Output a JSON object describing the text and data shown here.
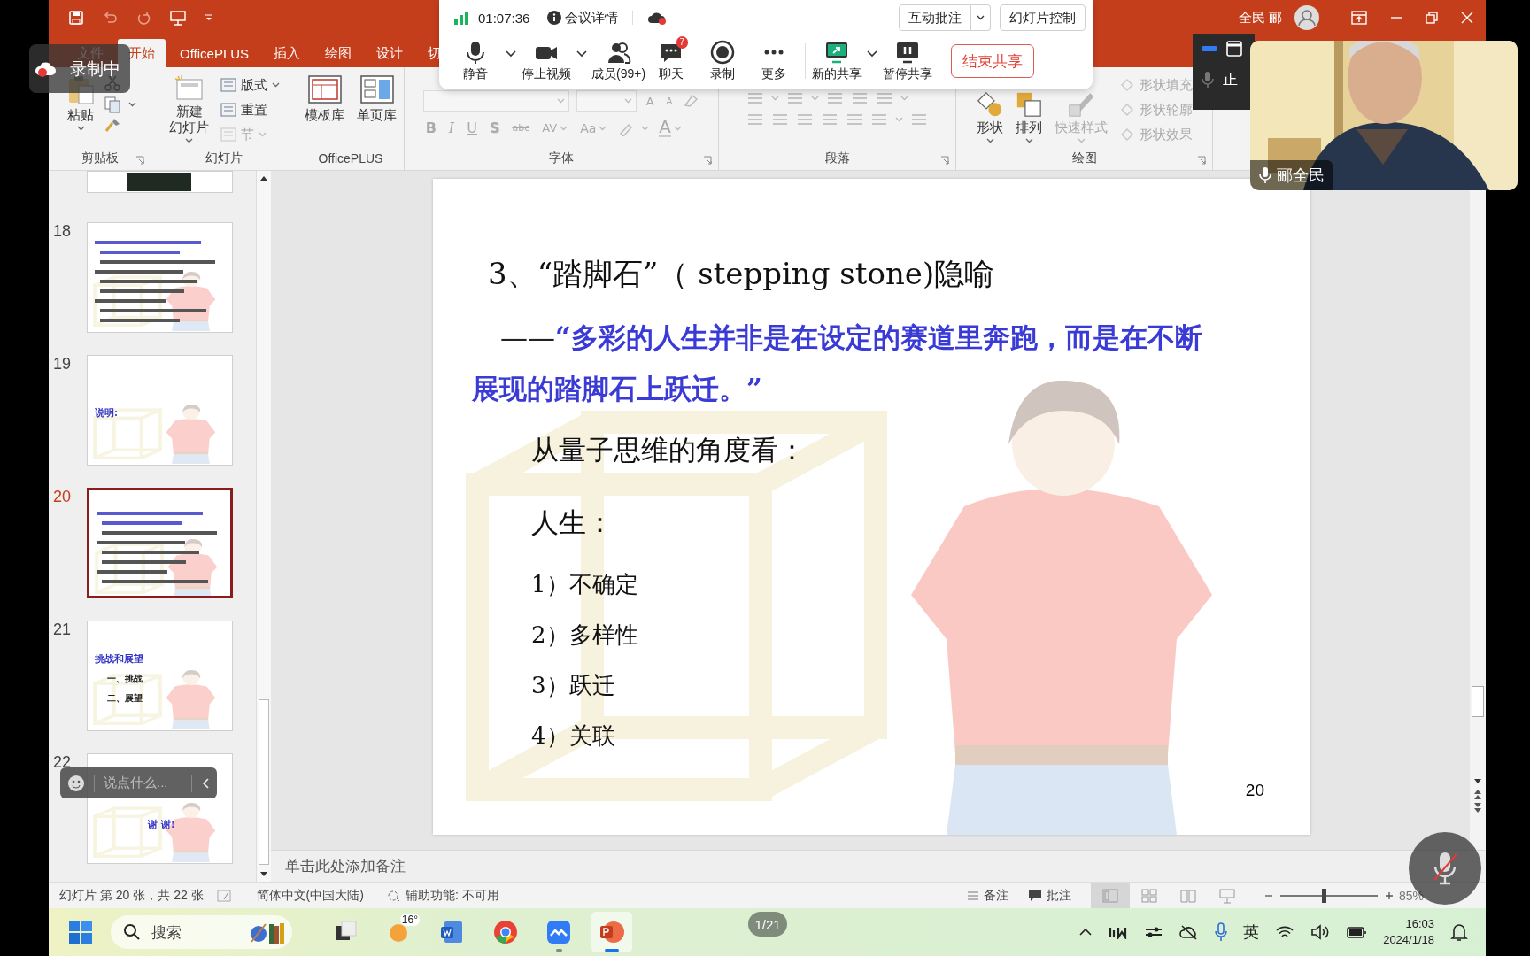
{
  "title_bar": {
    "user": "全民 郦"
  },
  "recording_badge": {
    "label": "录制中"
  },
  "ribbon": {
    "tabs": [
      {
        "label": "文件",
        "selected": false
      },
      {
        "label": "开始",
        "selected": true
      },
      {
        "label": "OfficePLUS",
        "selected": false
      },
      {
        "label": "插入",
        "selected": false
      },
      {
        "label": "绘图",
        "selected": false
      },
      {
        "label": "设计",
        "selected": false
      },
      {
        "label": "切",
        "selected": false
      }
    ],
    "clipboard": {
      "label": "剪贴板",
      "paste": "粘贴"
    },
    "slides": {
      "label": "幻灯片",
      "new_slide": [
        "新建",
        "幻灯片"
      ],
      "items": [
        {
          "label": "版式",
          "disabled": false
        },
        {
          "label": "重置",
          "disabled": false
        },
        {
          "label": "节",
          "disabled": true
        }
      ]
    },
    "officeplus": {
      "label": "OfficePLUS",
      "buttons": [
        "模板库",
        "单页库"
      ]
    },
    "font": {
      "label": "字体",
      "size_buttons": [
        {
          "kind": "grow",
          "label": "A",
          "disabled": true
        },
        {
          "kind": "shrink",
          "label": "A",
          "disabled": true
        }
      ],
      "buttons": [
        {
          "kind": "bold",
          "label": "B",
          "disabled": true
        },
        {
          "kind": "italic",
          "label": "I",
          "disabled": true
        },
        {
          "kind": "underline",
          "label": "U",
          "disabled": true
        },
        {
          "kind": "shadow",
          "label": "S",
          "disabled": true
        },
        {
          "kind": "strike",
          "label": "abc",
          "disabled": true
        },
        {
          "kind": "spacing",
          "label": "AV",
          "disabled": true
        },
        {
          "kind": "case",
          "label": "Aa",
          "disabled": true
        },
        {
          "kind": "color",
          "label": "A",
          "disabled": true
        }
      ]
    },
    "paragraph": {
      "label": "段落"
    },
    "drawing": {
      "label": "绘图",
      "big_buttons": [
        {
          "label": "形状",
          "disabled": false
        },
        {
          "label": "排列",
          "disabled": false
        },
        {
          "label": "快速样式",
          "disabled": true
        }
      ],
      "small_buttons": [
        {
          "label": "形状填充",
          "disabled": true
        },
        {
          "label": "形状轮廓",
          "disabled": true
        },
        {
          "label": "形状效果",
          "disabled": true
        }
      ]
    }
  },
  "meeting_toolbar": {
    "timer": "01:07:36",
    "details": "会议详情",
    "annotate": "互动批注",
    "slide_control": "幻灯片控制",
    "end_share": "结束共享",
    "buttons": [
      {
        "kind": "mic",
        "label": "静音",
        "menu": true
      },
      {
        "kind": "camera",
        "label": "停止视频",
        "menu": true
      },
      {
        "kind": "members",
        "label": "成员(99+)",
        "menu": false
      },
      {
        "kind": "chat",
        "label": "聊天",
        "menu": false,
        "badge": "7"
      },
      {
        "kind": "record",
        "label": "录制",
        "menu": false
      },
      {
        "kind": "more",
        "label": "更多",
        "menu": false
      },
      {
        "kind": "share",
        "label": "新的共享",
        "menu": true
      },
      {
        "kind": "pause",
        "label": "暂停共享",
        "menu": false
      }
    ]
  },
  "floating_panel": {
    "label": "正"
  },
  "video_tile": {
    "name": "郦全民"
  },
  "thumbnails": [
    {
      "kind": "partial",
      "selected": false
    },
    {
      "kind": "slide",
      "number": "18",
      "selected": false
    },
    {
      "kind": "slide",
      "number": "19",
      "selected": false,
      "texts": [
        "说明:"
      ]
    },
    {
      "kind": "slide",
      "number": "20",
      "selected": true
    },
    {
      "kind": "slide",
      "number": "21",
      "selected": false,
      "texts": [
        "挑战和展望",
        "一、挑战",
        "二、展望"
      ]
    },
    {
      "kind": "slide",
      "number": "22",
      "selected": false,
      "texts": [
        "谢 谢!"
      ]
    }
  ],
  "chat_input": {
    "placeholder": "说点什么..."
  },
  "slide": {
    "title": "3、“踏脚石”（ stepping stone)隐喻",
    "quote_dash": "——",
    "quote": "“多彩的人生并非是在设定的赛道里奔跑，而是在不断展现的踏脚石上跃迁。”",
    "lead": "从量子思维的角度看：",
    "subhead": "人生：",
    "points": [
      "1）不确定",
      "2）多样性",
      "3）跃迁",
      "4）关联"
    ],
    "page_number": "20"
  },
  "notes": {
    "placeholder": "单击此处添加备注"
  },
  "status_bar": {
    "slide_info": "幻灯片 第 20 张，共 22 张",
    "language": "简体中文(中国大陆)",
    "accessibility": "辅助功能: 不可用",
    "notes": "备注",
    "comments": "批注",
    "views": [
      {
        "kind": "normal",
        "selected": true
      },
      {
        "kind": "sorter",
        "selected": false
      },
      {
        "kind": "reading",
        "selected": false
      },
      {
        "kind": "show",
        "selected": false
      }
    ],
    "zoom": {
      "level": 0.45
    },
    "zoom_value": "85%"
  },
  "taskbar": {
    "search": "搜索",
    "page_counter": "1/21",
    "ime": "英",
    "time": "16:03",
    "date": "2024/1/18",
    "apps": [
      {
        "kind": "taskview",
        "active": false,
        "running": false
      },
      {
        "kind": "weather",
        "label": "16°",
        "active": false,
        "running": false
      },
      {
        "kind": "word",
        "active": false,
        "running": false
      },
      {
        "kind": "chrome",
        "active": false,
        "running": false
      },
      {
        "kind": "meeting",
        "active": false,
        "running": true
      },
      {
        "kind": "powerpoint",
        "active": true,
        "running": true
      }
    ]
  }
}
